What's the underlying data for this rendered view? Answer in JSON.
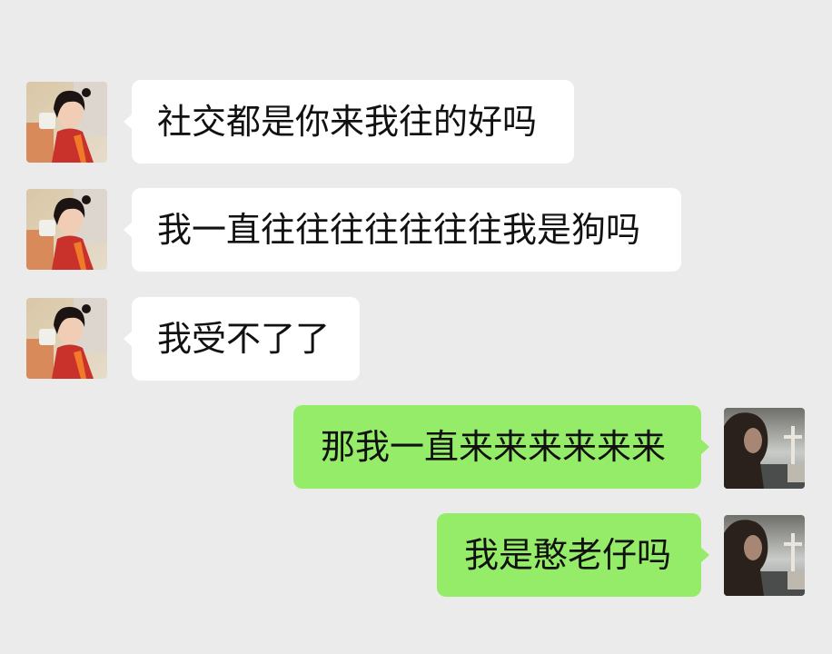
{
  "chat": {
    "messages": [
      {
        "sender": "contact",
        "text": "社交都是你来我往的好吗"
      },
      {
        "sender": "contact",
        "text": "我一直往往往往往往往我是狗吗"
      },
      {
        "sender": "contact",
        "text": "我受不了了"
      },
      {
        "sender": "me",
        "text": "那我一直来来来来来来"
      },
      {
        "sender": "me",
        "text": "我是憨老仔吗"
      }
    ]
  },
  "colors": {
    "background": "#ebebeb",
    "incoming_bubble": "#ffffff",
    "outgoing_bubble": "#95ec69",
    "text": "#111111"
  },
  "icons": {
    "contact_avatar": "contact-avatar-photo",
    "my_avatar": "my-avatar-photo"
  }
}
